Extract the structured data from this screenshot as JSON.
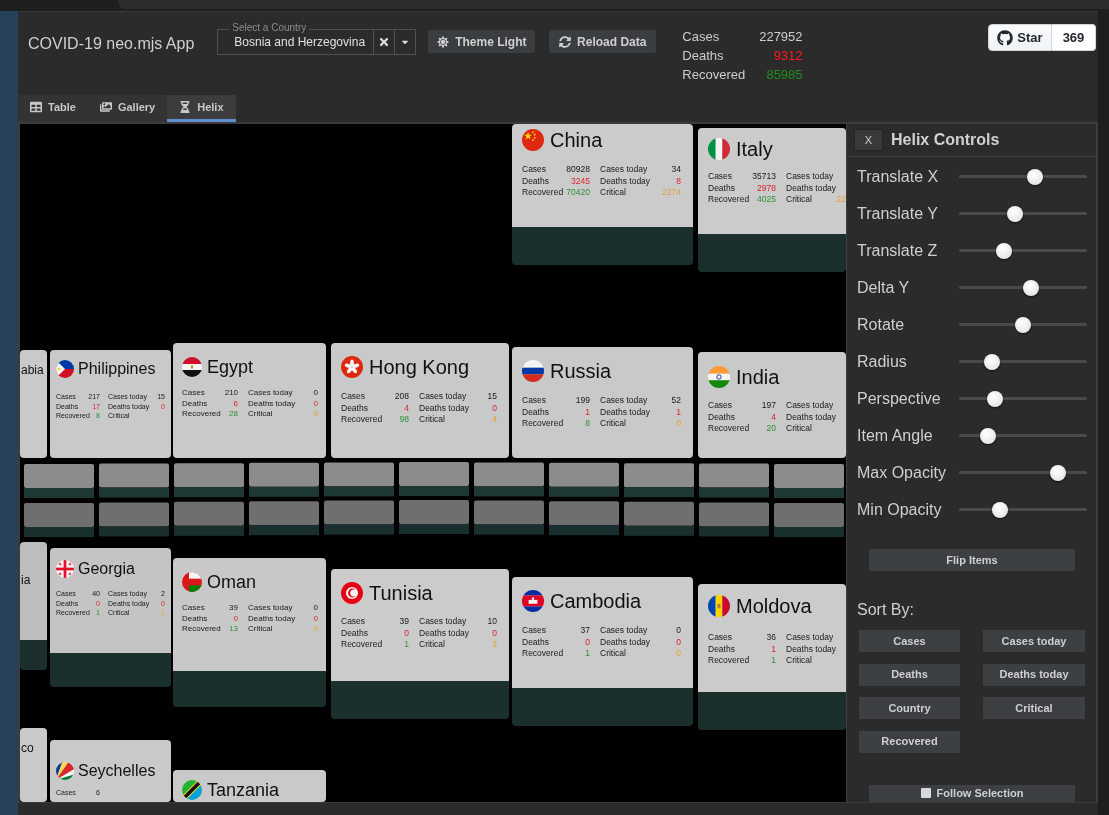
{
  "header": {
    "title": "COVID-19 neo.mjs App",
    "country_field": {
      "label": "Select a Country",
      "value": "Bosnia and Herzegovina"
    },
    "buttons": [
      "Theme Light",
      "Reload Data"
    ],
    "summary": [
      {
        "label": "Cases",
        "value": "227952",
        "color": "#cdcdcd"
      },
      {
        "label": "Deaths",
        "value": "9312",
        "color": "#ff1a1a"
      },
      {
        "label": "Recovered",
        "value": "85985",
        "color": "#1f8f1f"
      }
    ],
    "github": {
      "label": "Star",
      "count": "369"
    }
  },
  "tabs": [
    {
      "label": "Table",
      "selected": false
    },
    {
      "label": "Gallery",
      "selected": false
    },
    {
      "label": "Helix",
      "selected": true
    }
  ],
  "helix": {
    "cards": [
      {
        "title": "China",
        "left": [
          {
            "label": "Cases",
            "value": "80928",
            "kind": "plain"
          },
          {
            "label": "Deaths",
            "value": "3245",
            "kind": "deaths"
          },
          {
            "label": "Recovered",
            "value": "70420",
            "kind": "recovered"
          }
        ],
        "right": [
          {
            "label": "Cases today",
            "value": "34",
            "kind": "plain"
          },
          {
            "label": "Deaths today",
            "value": "8",
            "kind": "deaths"
          },
          {
            "label": "Critical",
            "value": "2274",
            "kind": "critical"
          }
        ]
      },
      {
        "title": "Italy",
        "left": [
          {
            "label": "Cases",
            "value": "35713",
            "kind": "plain"
          },
          {
            "label": "Deaths",
            "value": "2978",
            "kind": "deaths"
          },
          {
            "label": "Recovered",
            "value": "4025",
            "kind": "recovered"
          }
        ],
        "right": [
          {
            "label": "Cases today"
          },
          {
            "label": "Deaths today"
          },
          {
            "label": "Critical",
            "value": "22",
            "kind": "critical"
          }
        ]
      },
      {
        "title": "abia"
      },
      {
        "title": "Philippines",
        "left": [
          {
            "label": "Cases",
            "value": "217",
            "kind": "plain"
          },
          {
            "label": "Deaths",
            "value": "17",
            "kind": "deaths"
          },
          {
            "label": "Recovered",
            "value": "8",
            "kind": "recovered"
          }
        ],
        "right": [
          {
            "label": "Cases today",
            "value": "15",
            "kind": "plain"
          },
          {
            "label": "Deaths today",
            "value": "0",
            "kind": "deaths"
          },
          {
            "label": "Critical"
          }
        ]
      },
      {
        "title": "Egypt",
        "left": [
          {
            "label": "Cases",
            "value": "210",
            "kind": "plain"
          },
          {
            "label": "Deaths",
            "value": "6",
            "kind": "deaths"
          },
          {
            "label": "Recovered",
            "value": "28",
            "kind": "recovered"
          }
        ],
        "right": [
          {
            "label": "Cases today",
            "value": "0",
            "kind": "plain"
          },
          {
            "label": "Deaths today",
            "value": "0",
            "kind": "deaths"
          },
          {
            "label": "Critical",
            "value": "0",
            "kind": "critical"
          }
        ]
      },
      {
        "title": "Hong Kong",
        "left": [
          {
            "label": "Cases",
            "value": "208",
            "kind": "plain"
          },
          {
            "label": "Deaths",
            "value": "4",
            "kind": "deaths"
          },
          {
            "label": "Recovered",
            "value": "98",
            "kind": "recovered"
          }
        ],
        "right": [
          {
            "label": "Cases today",
            "value": "15",
            "kind": "plain"
          },
          {
            "label": "Deaths today",
            "value": "0",
            "kind": "deaths"
          },
          {
            "label": "Critical",
            "value": "4",
            "kind": "critical"
          }
        ]
      },
      {
        "title": "Russia",
        "left": [
          {
            "label": "Cases",
            "value": "199",
            "kind": "plain"
          },
          {
            "label": "Deaths",
            "value": "1",
            "kind": "deaths"
          },
          {
            "label": "Recovered",
            "value": "8",
            "kind": "recovered"
          }
        ],
        "right": [
          {
            "label": "Cases today",
            "value": "52",
            "kind": "plain"
          },
          {
            "label": "Deaths today",
            "value": "1",
            "kind": "deaths"
          },
          {
            "label": "Critical",
            "value": "0",
            "kind": "critical"
          }
        ]
      },
      {
        "title": "India",
        "left": [
          {
            "label": "Cases",
            "value": "197",
            "kind": "plain"
          },
          {
            "label": "Deaths",
            "value": "4",
            "kind": "deaths"
          },
          {
            "label": "Recovered",
            "value": "20",
            "kind": "recovered"
          }
        ],
        "right": [
          {
            "label": "Cases today"
          },
          {
            "label": "Deaths today"
          },
          {
            "label": "Critical"
          }
        ]
      },
      {
        "title": "ia"
      },
      {
        "title": "Georgia",
        "left": [
          {
            "label": "Cases",
            "value": "40",
            "kind": "plain"
          },
          {
            "label": "Deaths",
            "value": "0",
            "kind": "deaths"
          },
          {
            "label": "Recovered",
            "value": "1",
            "kind": "recovered"
          }
        ],
        "right": [
          {
            "label": "Cases today",
            "value": "2",
            "kind": "plain"
          },
          {
            "label": "Deaths today",
            "value": "0",
            "kind": "deaths"
          },
          {
            "label": "Critical",
            "value": "1",
            "kind": "critical"
          }
        ]
      },
      {
        "title": "Oman",
        "left": [
          {
            "label": "Cases",
            "value": "39",
            "kind": "plain"
          },
          {
            "label": "Deaths",
            "value": "0",
            "kind": "deaths"
          },
          {
            "label": "Recovered",
            "value": "13",
            "kind": "recovered"
          }
        ],
        "right": [
          {
            "label": "Cases today",
            "value": "0",
            "kind": "plain"
          },
          {
            "label": "Deaths today",
            "value": "0",
            "kind": "deaths"
          },
          {
            "label": "Critical",
            "value": "0",
            "kind": "critical"
          }
        ]
      },
      {
        "title": "Tunisia",
        "left": [
          {
            "label": "Cases",
            "value": "39",
            "kind": "plain"
          },
          {
            "label": "Deaths",
            "value": "0",
            "kind": "deaths"
          },
          {
            "label": "Recovered",
            "value": "1",
            "kind": "recovered"
          }
        ],
        "right": [
          {
            "label": "Cases today",
            "value": "10",
            "kind": "plain"
          },
          {
            "label": "Deaths today",
            "value": "0",
            "kind": "deaths"
          },
          {
            "label": "Critical",
            "value": "2",
            "kind": "critical"
          }
        ]
      },
      {
        "title": "Cambodia",
        "left": [
          {
            "label": "Cases",
            "value": "37",
            "kind": "plain"
          },
          {
            "label": "Deaths",
            "value": "0",
            "kind": "deaths"
          },
          {
            "label": "Recovered",
            "value": "1",
            "kind": "recovered"
          }
        ],
        "right": [
          {
            "label": "Cases today",
            "value": "0",
            "kind": "plain"
          },
          {
            "label": "Deaths today",
            "value": "0",
            "kind": "deaths"
          },
          {
            "label": "Critical",
            "value": "0",
            "kind": "critical"
          }
        ]
      },
      {
        "title": "Moldova",
        "left": [
          {
            "label": "Cases",
            "value": "36",
            "kind": "plain"
          },
          {
            "label": "Deaths",
            "value": "1",
            "kind": "deaths"
          },
          {
            "label": "Recovered",
            "value": "1",
            "kind": "recovered"
          }
        ],
        "right": [
          {
            "label": "Cases today"
          },
          {
            "label": "Deaths today"
          },
          {
            "label": "Critical"
          }
        ]
      },
      {
        "title": "co"
      },
      {
        "title": "Seychelles",
        "left": [
          {
            "label": "Cases",
            "value": "6",
            "kind": "plain"
          }
        ]
      },
      {
        "title": "Tanzania"
      }
    ]
  },
  "controls": {
    "close": "X",
    "title": "Helix Controls",
    "sliders": [
      {
        "label": "Translate X",
        "level": 0.59
      },
      {
        "label": "Translate Y",
        "level": 0.44
      },
      {
        "label": "Translate Z",
        "level": 0.35
      },
      {
        "label": "Delta Y",
        "level": 0.56
      },
      {
        "label": "Rotate",
        "level": 0.5
      },
      {
        "label": "Radius",
        "level": 0.26
      },
      {
        "label": "Perspective",
        "level": 0.28
      },
      {
        "label": "Item Angle",
        "level": 0.23
      },
      {
        "label": "Max Opacity",
        "level": 0.77
      },
      {
        "label": "Min Opacity",
        "level": 0.32
      }
    ],
    "flip_button": "Flip Items",
    "sort_label": "Sort By:",
    "sort_buttons": [
      "Cases",
      "Cases today",
      "Deaths",
      "Deaths today",
      "Country",
      "Critical",
      "Recovered"
    ],
    "follow_selection": {
      "label": "Follow Selection",
      "checked": false
    }
  }
}
